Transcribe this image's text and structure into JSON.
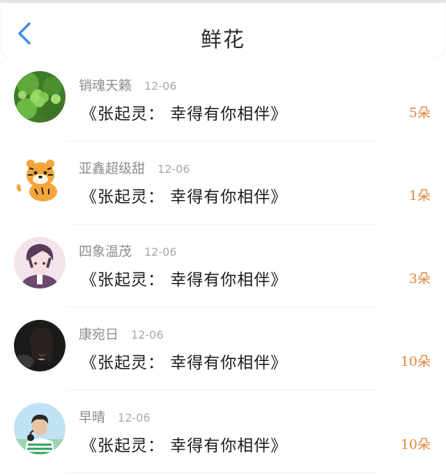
{
  "header": {
    "title": "鲜花",
    "back_icon": "chevron-left-icon",
    "accent_color": "#3a8ee6"
  },
  "rows": [
    {
      "name": "销魂天籁",
      "date": "12-06",
      "book": "《张起灵： 幸得有你相伴》",
      "count": "5朵",
      "avatar": "clover-avatar"
    },
    {
      "name": "亚鑫超级甜",
      "date": "12-06",
      "book": "《张起灵： 幸得有你相伴》",
      "count": "1朵",
      "avatar": "tiger-avatar"
    },
    {
      "name": "四象温茂",
      "date": "12-06",
      "book": "《张起灵： 幸得有你相伴》",
      "count": "3朵",
      "avatar": "anime-boy-avatar"
    },
    {
      "name": "康宛日",
      "date": "12-06",
      "book": "《张起灵： 幸得有你相伴》",
      "count": "10朵",
      "avatar": "portrait-avatar"
    },
    {
      "name": "早晴",
      "date": "12-06",
      "book": "《张起灵： 幸得有你相伴》",
      "count": "10朵",
      "avatar": "person-headphones-avatar"
    }
  ],
  "colors": {
    "count": "#e0833a",
    "name": "#8c8c8c",
    "date": "#a8a8a8"
  }
}
